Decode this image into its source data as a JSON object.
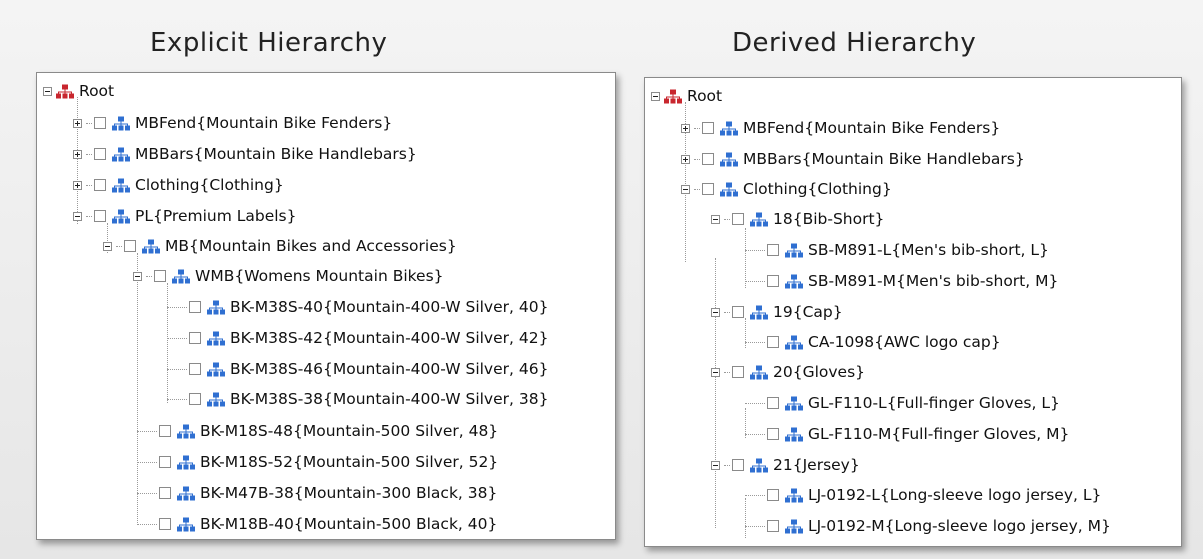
{
  "explicit": {
    "title": "Explicit Hierarchy",
    "root": "Root",
    "items": [
      "MBFend{Mountain Bike Fenders}",
      "MBBars{Mountain Bike Handlebars}",
      "Clothing{Clothing}",
      "PL{Premium Labels}",
      "MB{Mountain Bikes and Accessories}",
      "WMB{Womens Mountain Bikes}",
      "BK-M38S-40{Mountain-400-W Silver, 40}",
      "BK-M38S-42{Mountain-400-W Silver, 42}",
      "BK-M38S-46{Mountain-400-W Silver, 46}",
      "BK-M38S-38{Mountain-400-W Silver, 38}",
      "BK-M18S-48{Mountain-500 Silver, 48}",
      "BK-M18S-52{Mountain-500 Silver, 52}",
      "BK-M47B-38{Mountain-300 Black, 38}",
      "BK-M18B-40{Mountain-500 Black, 40}"
    ]
  },
  "derived": {
    "title": "Derived Hierarchy",
    "root": "Root",
    "items": [
      "MBFend{Mountain Bike Fenders}",
      "MBBars{Mountain Bike Handlebars}",
      "Clothing{Clothing}",
      "18{Bib-Short}",
      "SB-M891-L{Men's bib-short, L}",
      "SB-M891-M{Men's bib-short, M}",
      "19{Cap}",
      "CA-1098{AWC logo cap}",
      "20{Gloves}",
      "GL-F110-L{Full-finger Gloves, L}",
      "GL-F110-M{Full-finger Gloves, M}",
      "21{Jersey}",
      "LJ-0192-L{Long-sleeve logo jersey, L}",
      "LJ-0192-M{Long-sleeve logo jersey, M}"
    ]
  },
  "icons": {
    "root": "hierarchy-root-icon",
    "node": "hierarchy-node-icon"
  },
  "colors": {
    "root_icon": "#c8262e",
    "node_icon": "#2f6fd1"
  }
}
